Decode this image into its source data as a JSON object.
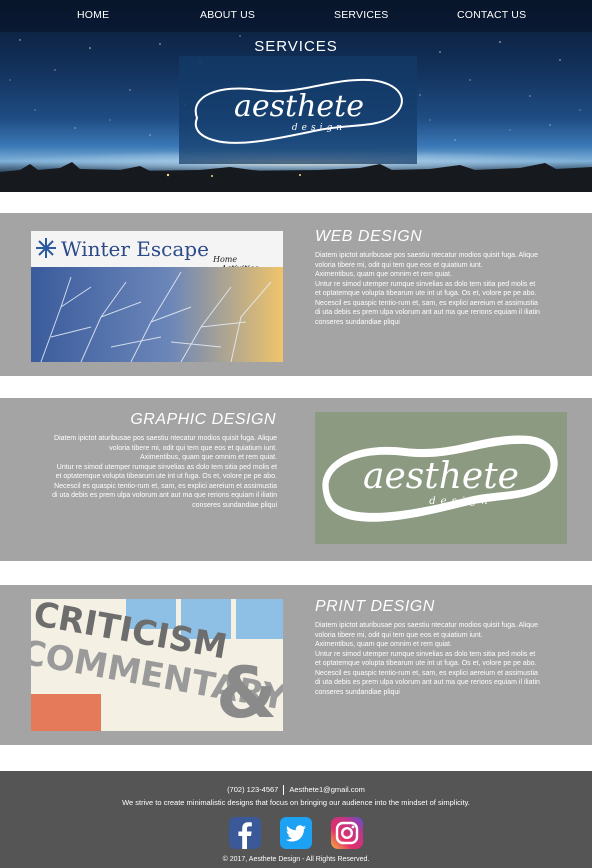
{
  "nav": {
    "items": [
      {
        "label": "HOME"
      },
      {
        "label": "ABOUT US"
      },
      {
        "label": "SERVICES"
      },
      {
        "label": "CONTACT US"
      }
    ]
  },
  "hero": {
    "title": "SERVICES",
    "logo_word": "aesthete",
    "logo_sub": "design"
  },
  "sections": [
    {
      "title": "WEB DESIGN",
      "image_caption": "Winter Escape",
      "image_nav": [
        "Home",
        "Activities"
      ],
      "body": [
        "Diatem ipictot aturibusae pos saestiu ntecatur modios quisit fuga. Alique voloria tibere mi, odit qui tem que eos et quiatium iunt.",
        "Aximentibus, quam que omnim et rem quiat.",
        "Untur re simod utemper rumque sinvelias as dolo tem sitia ped molis et et optatemque volupta tibearum ute int ut fuga. Os et, volore pe pe abo. Necescil es quaspic tentio-rum et, sam, es explici aereium et assimustia di uta debis es prem ulpa volorum ant aut ma que rerions equiam il iliatin conseres sundandiae pliqui"
      ]
    },
    {
      "title": "GRAPHIC DESIGN",
      "logo_word": "aesthete",
      "logo_sub": "design",
      "body": [
        "Diatem ipictot aturibusae pos saestiu ntecatur modios quisit fuga. Alique voloria tibere mi, odit qui tem que eos et quiatium iunt.",
        "Aximentibus, quam que omnim et rem quiat.",
        "Untur re simod utemper rumque sinvelias as dolo tem sitia ped molis et et optatemque volupta tibearum ute int ut fuga. Os et, volore pe pe abo. Necescil es quaspic tentio-rum et, sam, es explici aereium et assimustia di uta debis es prem ulpa volorum ant aut ma que rerions equiam il iliatin conseres sundandiae pliqui"
      ]
    },
    {
      "title": "PRINT DESIGN",
      "image_word1": "CRITICISM",
      "image_word2": "COMMENTARY",
      "image_amp": "&",
      "body": [
        "Diatem ipictot aturibusae pos saestiu ntecatur modios quisit fuga. Alique voloria tibere mi, odit qui tem que eos et quiatium iunt.",
        "Aximentibus, quam que omnim et rem quiat.",
        "Untur re simod utemper rumque sinvelias as dolo tem sitia ped molis et et optatemque volupta tibearum ute int ut fuga. Os et, volore pe pe abo. Necescil es quaspic tentio-rum et, sam, es explici aereium et assimustia di uta debis es prem ulpa volorum ant aut ma que rerions equiam il iliatin conseres sundandiae pliqui"
      ]
    }
  ],
  "footer": {
    "phone": "(702) 123-4567",
    "email": "Aesthete1@gmail.com",
    "tagline": "We strive to create minimalistic designs that focus on bringing our audience into the mindset of simplicity.",
    "social": [
      {
        "icon": "facebook-icon",
        "color": "#3b5998"
      },
      {
        "icon": "twitter-icon",
        "color": "#1da1f2"
      },
      {
        "icon": "instagram-icon",
        "color": "#c13584"
      }
    ],
    "copyright": "© 2017, Aesthete Design - All Rights Reserved."
  },
  "colors": {
    "section_bg": "#a4a4a4",
    "footer_bg": "#555555",
    "logo_green": "#8c9a82"
  }
}
